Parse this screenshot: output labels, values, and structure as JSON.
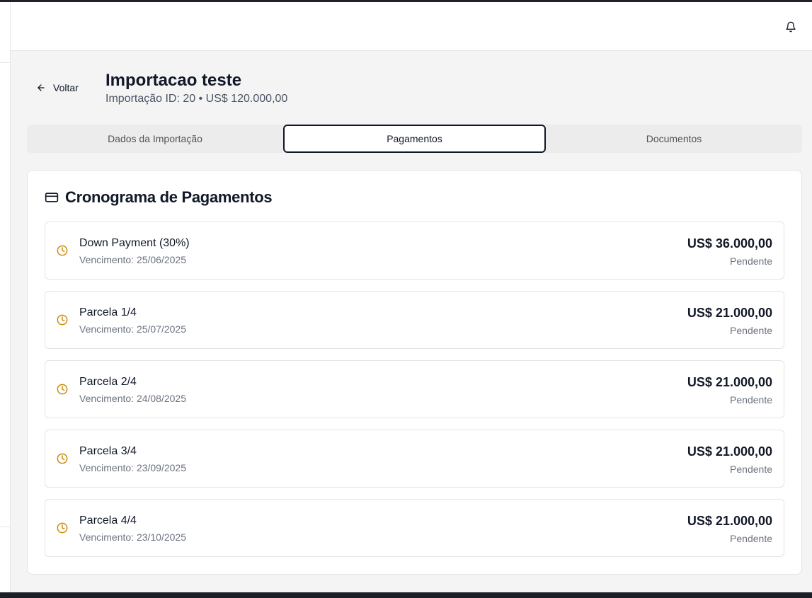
{
  "header": {
    "notifications_icon": "bell-icon"
  },
  "page": {
    "back_label": "Voltar",
    "title": "Importacao teste",
    "subtitle": "Importação ID: 20 • US$ 120.000,00"
  },
  "tabs": [
    {
      "label": "Dados da Importação",
      "active": false
    },
    {
      "label": "Pagamentos",
      "active": true
    },
    {
      "label": "Documentos",
      "active": false
    }
  ],
  "schedule": {
    "title": "Cronograma de Pagamentos",
    "title_icon": "credit-card-icon",
    "accent_color": "#ca8a04",
    "items": [
      {
        "name": "Down Payment (30%)",
        "due": "Vencimento: 25/06/2025",
        "amount": "US$ 36.000,00",
        "status": "Pendente"
      },
      {
        "name": "Parcela 1/4",
        "due": "Vencimento: 25/07/2025",
        "amount": "US$ 21.000,00",
        "status": "Pendente"
      },
      {
        "name": "Parcela 2/4",
        "due": "Vencimento: 24/08/2025",
        "amount": "US$ 21.000,00",
        "status": "Pendente"
      },
      {
        "name": "Parcela 3/4",
        "due": "Vencimento: 23/09/2025",
        "amount": "US$ 21.000,00",
        "status": "Pendente"
      },
      {
        "name": "Parcela 4/4",
        "due": "Vencimento: 23/10/2025",
        "amount": "US$ 21.000,00",
        "status": "Pendente"
      }
    ]
  }
}
